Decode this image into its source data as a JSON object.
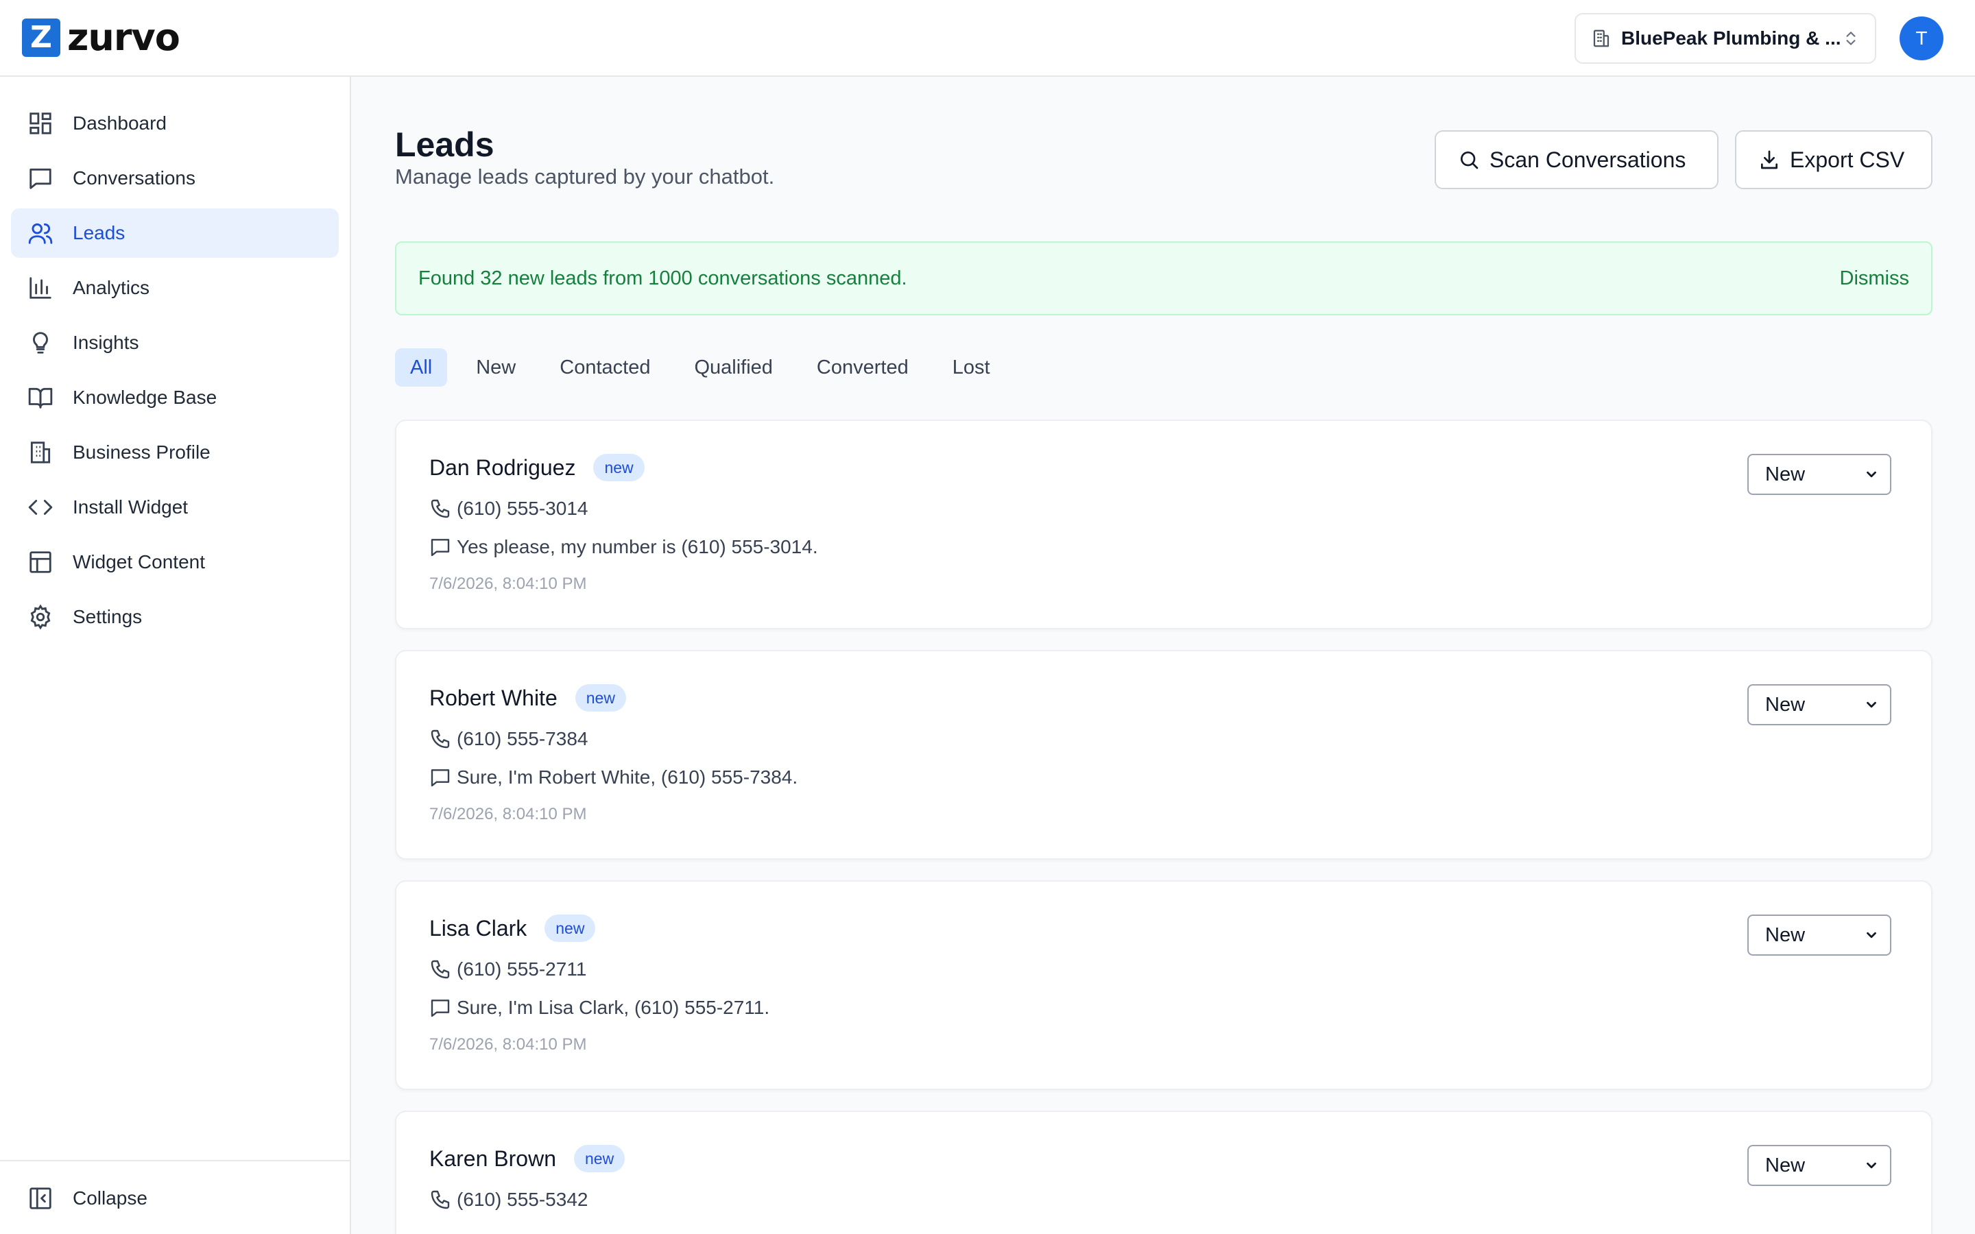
{
  "brand": {
    "logo_letter": "Z",
    "name": "zurvo",
    "accent": "#1d6fd8"
  },
  "org": {
    "name": "BluePeak Plumbing & ..."
  },
  "user": {
    "initial": "T"
  },
  "sidebar": {
    "items": [
      {
        "label": "Dashboard",
        "icon": "dashboard-icon"
      },
      {
        "label": "Conversations",
        "icon": "chat-icon"
      },
      {
        "label": "Leads",
        "icon": "users-icon",
        "active": true
      },
      {
        "label": "Analytics",
        "icon": "bar-chart-icon"
      },
      {
        "label": "Insights",
        "icon": "lightbulb-icon"
      },
      {
        "label": "Knowledge Base",
        "icon": "book-icon"
      },
      {
        "label": "Business Profile",
        "icon": "building-icon"
      },
      {
        "label": "Install Widget",
        "icon": "code-icon"
      },
      {
        "label": "Widget Content",
        "icon": "layout-icon"
      },
      {
        "label": "Settings",
        "icon": "gear-icon"
      }
    ],
    "collapse_label": "Collapse"
  },
  "header": {
    "title": "Leads",
    "subtitle": "Manage leads captured by your chatbot.",
    "scan_label": "Scan Conversations",
    "export_label": "Export CSV"
  },
  "banner": {
    "message": "Found 32 new leads from 1000 conversations scanned.",
    "dismiss_label": "Dismiss",
    "color": "#15803d"
  },
  "tabs": [
    {
      "label": "All",
      "active": true
    },
    {
      "label": "New"
    },
    {
      "label": "Contacted"
    },
    {
      "label": "Qualified"
    },
    {
      "label": "Converted"
    },
    {
      "label": "Lost"
    }
  ],
  "leads": [
    {
      "name": "Dan Rodriguez",
      "badge": "new",
      "phone": "(610) 555-3014",
      "message": "Yes please, my number is (610) 555-3014.",
      "time": "7/6/2026, 8:04:10 PM",
      "status": "New"
    },
    {
      "name": "Robert White",
      "badge": "new",
      "phone": "(610) 555-7384",
      "message": "Sure, I'm Robert White, (610) 555-7384.",
      "time": "7/6/2026, 8:04:10 PM",
      "status": "New"
    },
    {
      "name": "Lisa Clark",
      "badge": "new",
      "phone": "(610) 555-2711",
      "message": "Sure, I'm Lisa Clark, (610) 555-2711.",
      "time": "7/6/2026, 8:04:10 PM",
      "status": "New"
    },
    {
      "name": "Karen Brown",
      "badge": "new",
      "phone": "(610) 555-5342",
      "message": "",
      "time": "",
      "status": "New"
    }
  ]
}
